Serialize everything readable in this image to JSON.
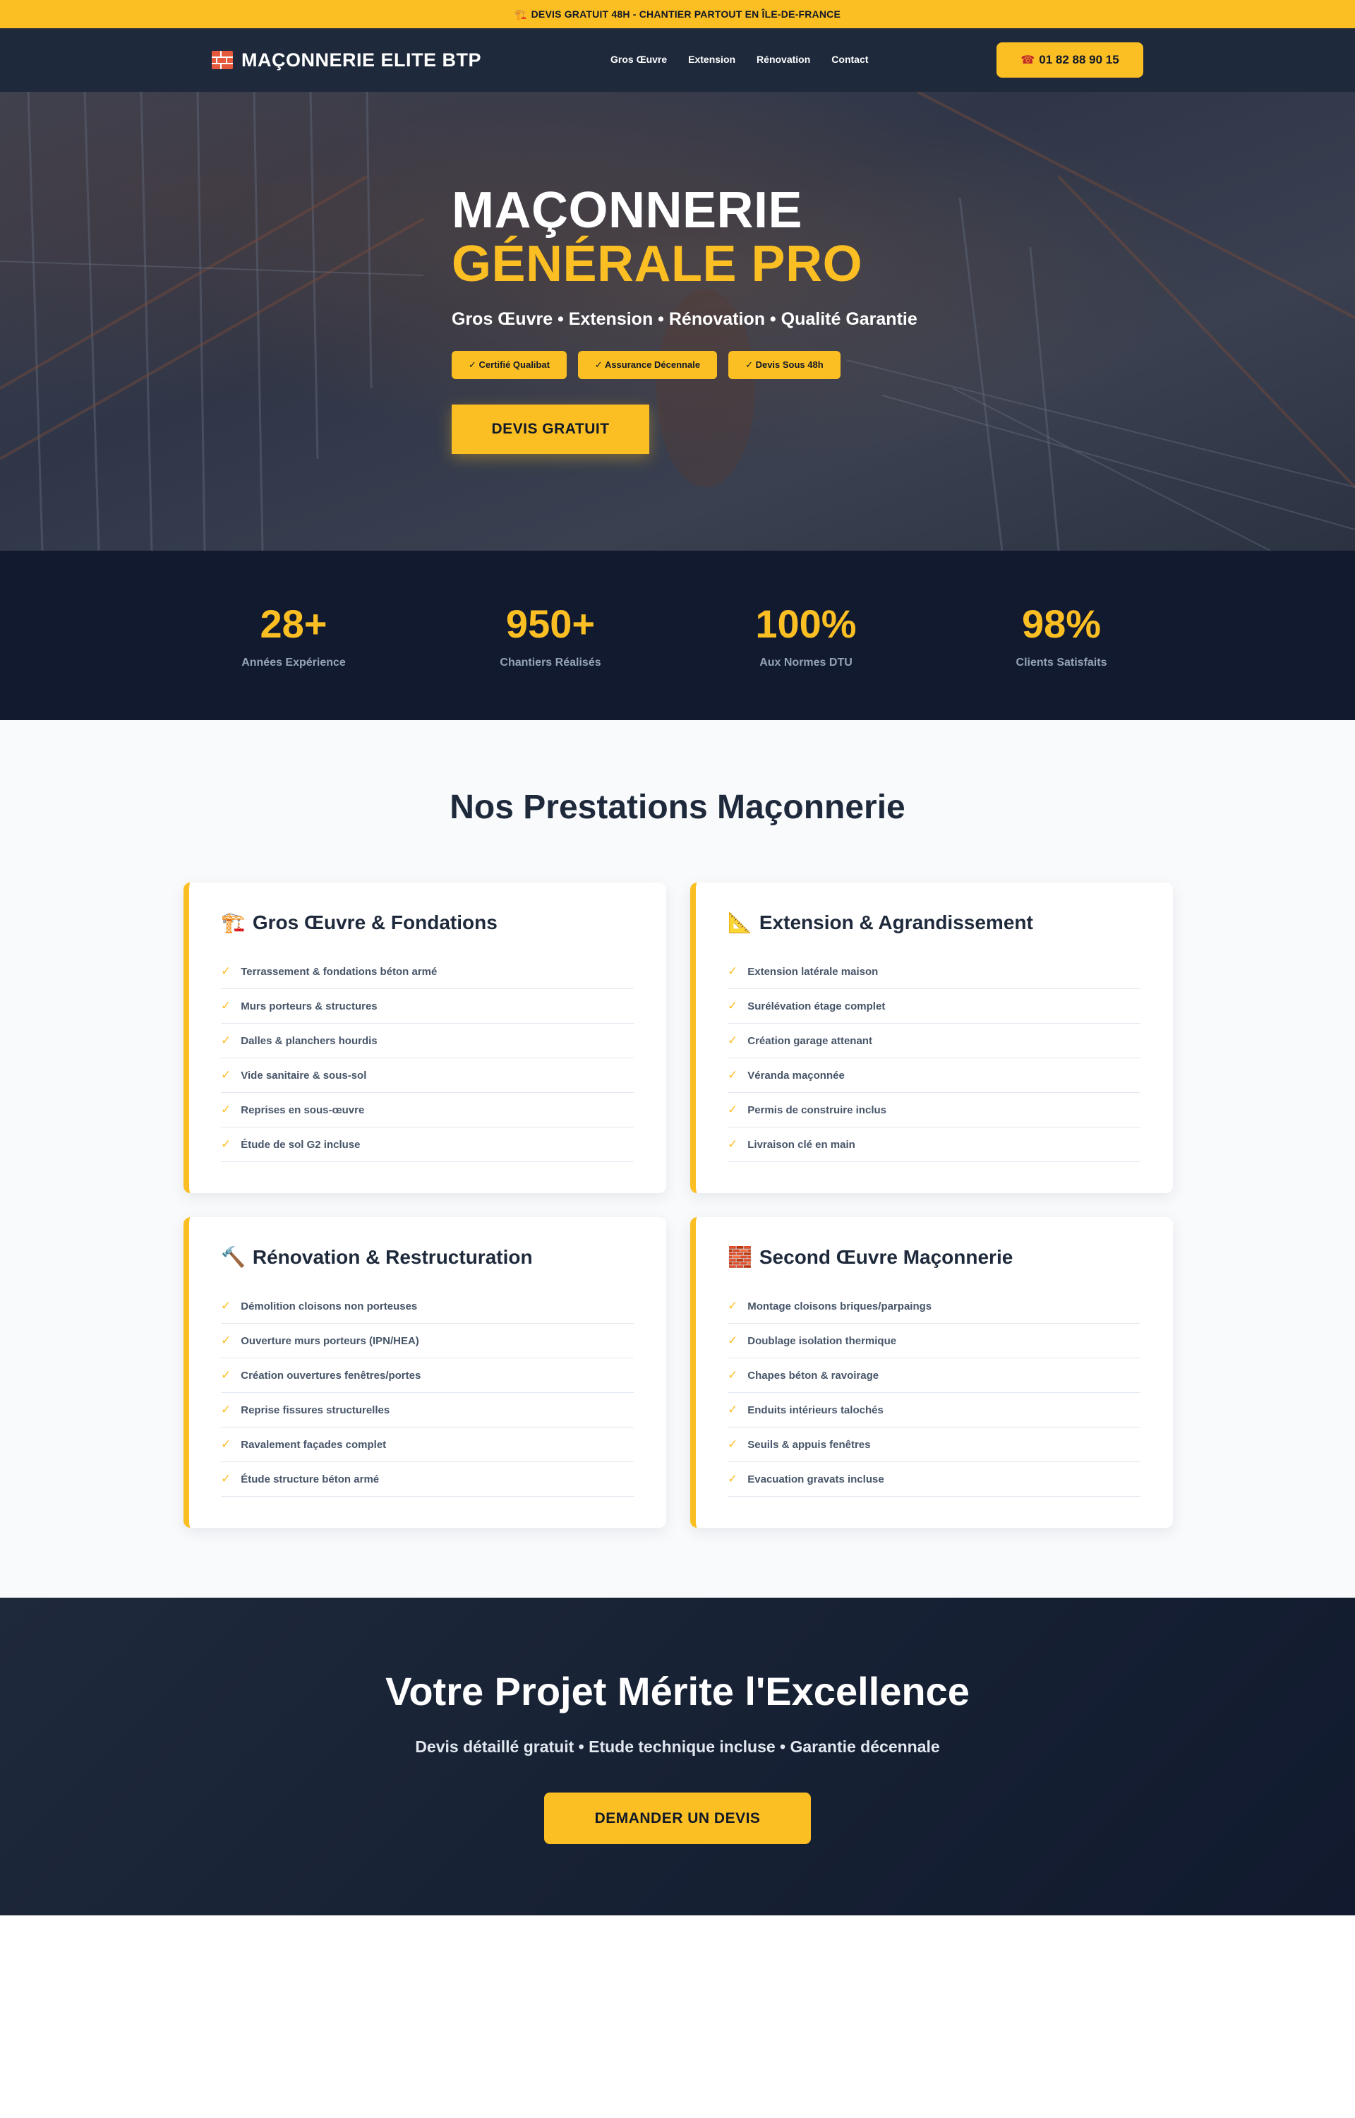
{
  "banner": {
    "icon": "🏗️",
    "text": "DEVIS GRATUIT 48H - CHANTIER PARTOUT EN ÎLE-DE-FRANCE"
  },
  "nav": {
    "brand_icon": "brick-icon",
    "brand": "MAÇONNERIE ELITE BTP",
    "links": [
      "Gros Œuvre",
      "Extension",
      "Rénovation",
      "Contact"
    ],
    "phone_icon": "☎",
    "phone": "01 82 88 90 15"
  },
  "hero": {
    "title_line1": "MAÇONNERIE",
    "title_line2": "GÉNÉRALE PRO",
    "subtitle": "Gros Œuvre • Extension • Rénovation • Qualité Garantie",
    "badges": [
      "✓ Certifié Qualibat",
      "✓ Assurance Décennale",
      "✓ Devis Sous 48h"
    ],
    "cta": "DEVIS GRATUIT"
  },
  "stats": [
    {
      "value": "28+",
      "label": "Années Expérience"
    },
    {
      "value": "950+",
      "label": "Chantiers Réalisés"
    },
    {
      "value": "100%",
      "label": "Aux Normes DTU"
    },
    {
      "value": "98%",
      "label": "Clients Satisfaits"
    }
  ],
  "services": {
    "title": "Nos Prestations Maçonnerie",
    "check_icon": "✓",
    "cards": [
      {
        "icon": "🏗️",
        "title": "Gros Œuvre & Fondations",
        "items": [
          "Terrassement & fondations béton armé",
          "Murs porteurs & structures",
          "Dalles & planchers hourdis",
          "Vide sanitaire & sous-sol",
          "Reprises en sous-œuvre",
          "Étude de sol G2 incluse"
        ]
      },
      {
        "icon": "📐",
        "title": "Extension & Agrandissement",
        "items": [
          "Extension latérale maison",
          "Surélévation étage complet",
          "Création garage attenant",
          "Véranda maçonnée",
          "Permis de construire inclus",
          "Livraison clé en main"
        ]
      },
      {
        "icon": "🔨",
        "title": "Rénovation & Restructuration",
        "items": [
          "Démolition cloisons non porteuses",
          "Ouverture murs porteurs (IPN/HEA)",
          "Création ouvertures fenêtres/portes",
          "Reprise fissures structurelles",
          "Ravalement façades complet",
          "Étude structure béton armé"
        ]
      },
      {
        "icon": "🧱",
        "title": "Second Œuvre Maçonnerie",
        "items": [
          "Montage cloisons briques/parpaings",
          "Doublage isolation thermique",
          "Chapes béton & ravoirage",
          "Enduits intérieurs talochés",
          "Seuils & appuis fenêtres",
          "Evacuation gravats incluse"
        ]
      }
    ]
  },
  "final": {
    "title": "Votre Projet Mérite l'Excellence",
    "subtitle": "Devis détaillé gratuit • Etude technique incluse • Garantie décennale",
    "cta": "DEMANDER UN DEVIS"
  },
  "colors": {
    "accent": "#fbbf24",
    "dark": "#1e293b",
    "darker": "#111a2e"
  }
}
